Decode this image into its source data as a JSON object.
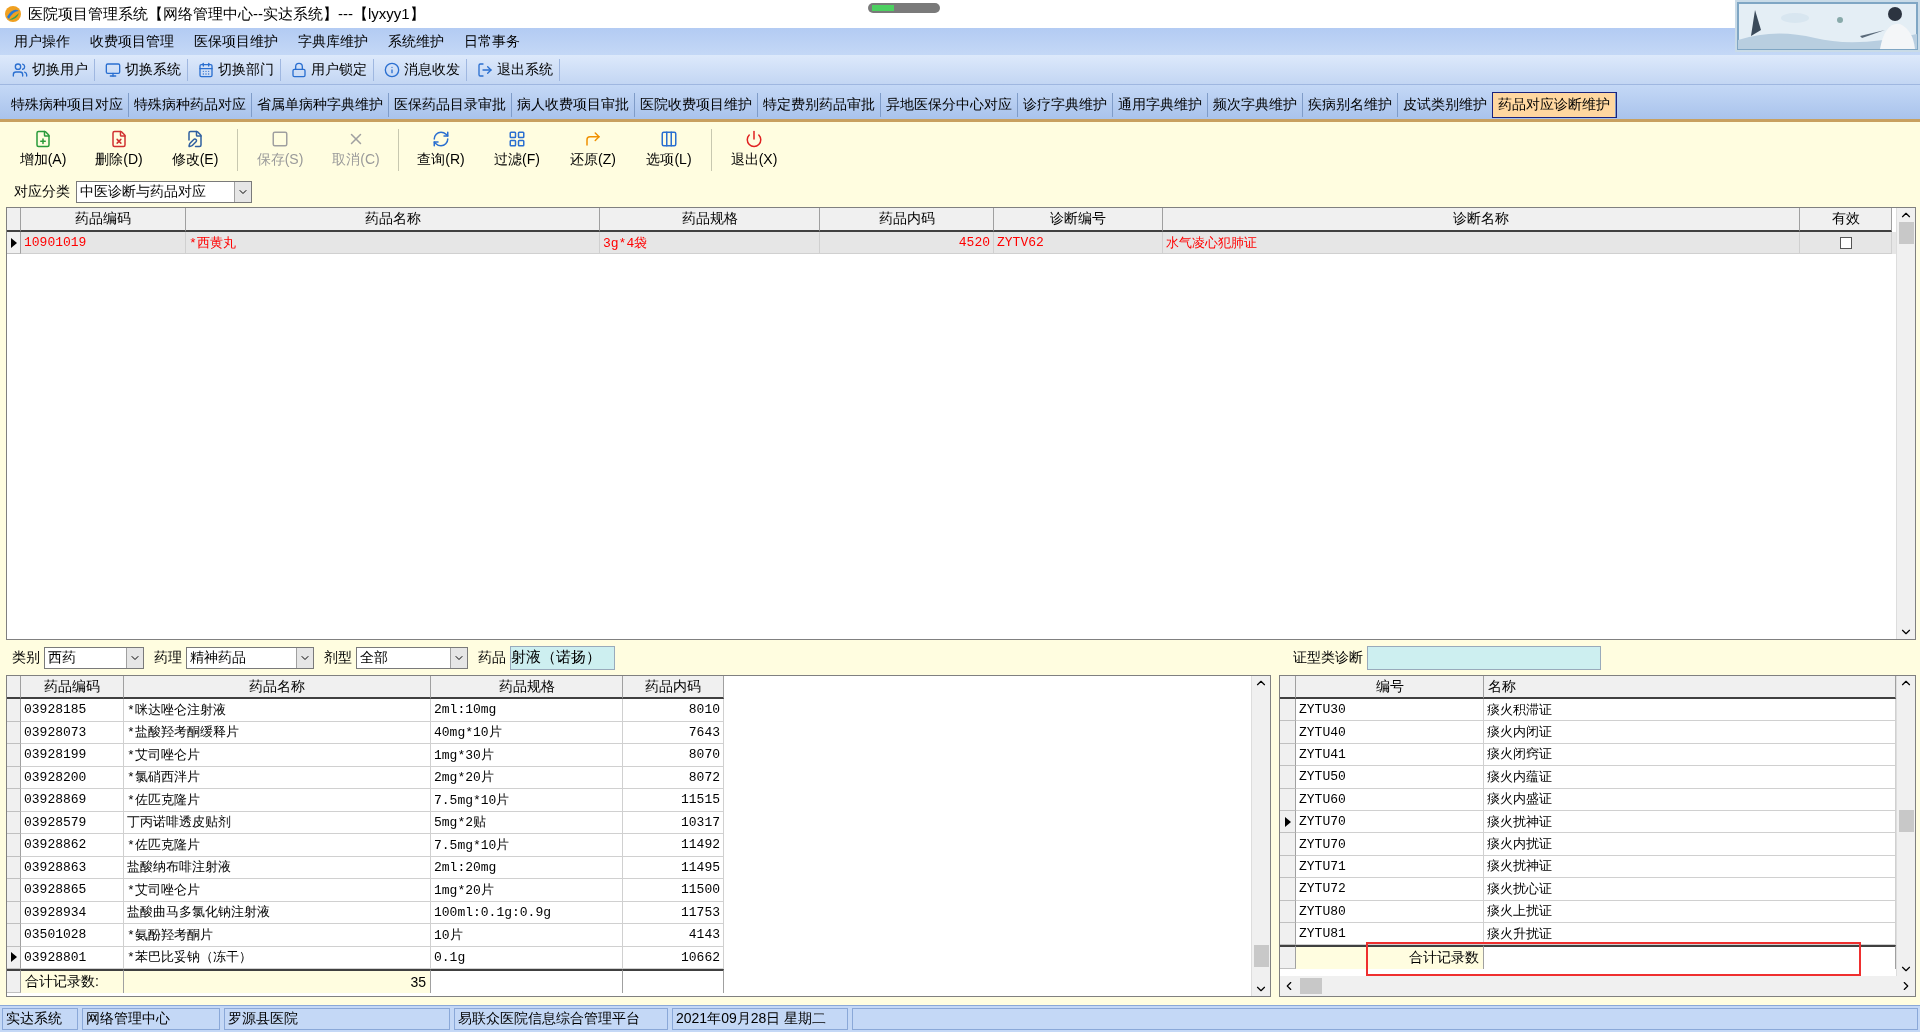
{
  "window": {
    "title": "医院项目管理系统【网络管理中心--实达系统】---【lyxyy1】"
  },
  "menu": [
    "用户操作",
    "收费项目管理",
    "医保项目维护",
    "字典库维护",
    "系统维护",
    "日常事务"
  ],
  "toolbar": [
    {
      "label": "切换用户"
    },
    {
      "label": "切换系统"
    },
    {
      "label": "切换部门"
    },
    {
      "label": "用户锁定"
    },
    {
      "label": "消息收发"
    },
    {
      "label": "退出系统"
    }
  ],
  "tabs": [
    {
      "label": "特殊病种项目对应",
      "selected": false
    },
    {
      "label": "特殊病种药品对应",
      "selected": false
    },
    {
      "label": "省属单病种字典维护",
      "selected": false
    },
    {
      "label": "医保药品目录审批",
      "selected": false
    },
    {
      "label": "病人收费项目审批",
      "selected": false
    },
    {
      "label": "医院收费项目维护",
      "selected": false
    },
    {
      "label": "特定费别药品审批",
      "selected": false
    },
    {
      "label": "异地医保分中心对应",
      "selected": false
    },
    {
      "label": "诊疗字典维护",
      "selected": false
    },
    {
      "label": "通用字典维护",
      "selected": false
    },
    {
      "label": "频次字典维护",
      "selected": false
    },
    {
      "label": "疾病别名维护",
      "selected": false
    },
    {
      "label": "皮试类别维护",
      "selected": false
    },
    {
      "label": "药品对应诊断维护",
      "selected": true
    }
  ],
  "actions": [
    {
      "label": "增加(A)",
      "disabled": false
    },
    {
      "label": "删除(D)",
      "disabled": false
    },
    {
      "label": "修改(E)",
      "disabled": false
    },
    {
      "label": "保存(S)",
      "disabled": true
    },
    {
      "label": "取消(C)",
      "disabled": true
    },
    {
      "label": "查询(R)",
      "disabled": false
    },
    {
      "label": "过滤(F)",
      "disabled": false
    },
    {
      "label": "还原(Z)",
      "disabled": false
    },
    {
      "label": "选项(L)",
      "disabled": false
    },
    {
      "label": "退出(X)",
      "disabled": false
    }
  ],
  "category": {
    "label": "对应分类",
    "value": "中医诊断与药品对应"
  },
  "main_table": {
    "columns": [
      "药品编码",
      "药品名称",
      "药品规格",
      "药品内码",
      "诊断编号",
      "诊断名称",
      "有效"
    ],
    "rows": [
      {
        "cells": [
          "10901019",
          "*西黄丸",
          "3g*4袋",
          "4520",
          "ZYTV62",
          "水气凌心犯肺证"
        ],
        "valid": false,
        "selected": true
      }
    ]
  },
  "filters": [
    {
      "kind": "dropdown",
      "label": "类别",
      "value": "西药"
    },
    {
      "kind": "dropdown",
      "label": "药理",
      "value": "精神药品"
    },
    {
      "kind": "dropdown",
      "label": "剂型",
      "value": "全部"
    },
    {
      "kind": "text",
      "label": "药品",
      "value": "射液（诺扬）"
    }
  ],
  "drug_table": {
    "columns": [
      "药品编码",
      "药品名称",
      "药品规格",
      "药品内码"
    ],
    "rows": [
      {
        "cells": [
          "03928185",
          "*咪达唑仑注射液",
          "2ml:10mg",
          "8010"
        ],
        "selected": false
      },
      {
        "cells": [
          "03928073",
          "*盐酸羟考酮缓释片",
          "40mg*10片",
          "7643"
        ],
        "selected": false
      },
      {
        "cells": [
          "03928199",
          "*艾司唑仑片",
          "1mg*30片",
          "8070"
        ],
        "selected": false
      },
      {
        "cells": [
          "03928200",
          "*氯硝西泮片",
          "2mg*20片",
          "8072"
        ],
        "selected": false
      },
      {
        "cells": [
          "03928869",
          "*佐匹克隆片",
          "7.5mg*10片",
          "11515"
        ],
        "selected": false
      },
      {
        "cells": [
          "03928579",
          "丁丙诺啡透皮贴剂",
          "5mg*2贴",
          "10317"
        ],
        "selected": false
      },
      {
        "cells": [
          "03928862",
          "*佐匹克隆片",
          "7.5mg*10片",
          "11492"
        ],
        "selected": false
      },
      {
        "cells": [
          "03928863",
          "盐酸纳布啡注射液",
          "2ml:20mg",
          "11495"
        ],
        "selected": false
      },
      {
        "cells": [
          "03928865",
          "*艾司唑仑片",
          "1mg*20片",
          "11500"
        ],
        "selected": false
      },
      {
        "cells": [
          "03928934",
          "盐酸曲马多氯化钠注射液",
          "100ml:0.1g:0.9g",
          "11753"
        ],
        "selected": false
      },
      {
        "cells": [
          "03501028",
          "*氨酚羟考酮片",
          "10片",
          "4143"
        ],
        "selected": false
      },
      {
        "cells": [
          "03928801",
          "*苯巴比妥钠（冻干）",
          "0.1g",
          "10662"
        ],
        "selected": true
      }
    ],
    "footer": {
      "label": "合计记录数:",
      "count": "35"
    }
  },
  "diagnosis_filter": {
    "label": "证型类诊断"
  },
  "diagnosis_table": {
    "columns": [
      "编号",
      "名称"
    ],
    "rows": [
      {
        "cells": [
          "ZYTU30",
          "痰火积滞证"
        ],
        "selected": false
      },
      {
        "cells": [
          "ZYTU40",
          "痰火内闭证"
        ],
        "selected": false
      },
      {
        "cells": [
          "ZYTU41",
          "痰火闭窍证"
        ],
        "selected": false
      },
      {
        "cells": [
          "ZYTU50",
          "痰火内蕴证"
        ],
        "selected": false
      },
      {
        "cells": [
          "ZYTU60",
          "痰火内盛证"
        ],
        "selected": false
      },
      {
        "cells": [
          "ZYTU70",
          "痰火扰神证"
        ],
        "selected": true
      },
      {
        "cells": [
          "ZYTU70",
          "痰火内扰证"
        ],
        "selected": false
      },
      {
        "cells": [
          "ZYTU71",
          "痰火扰神证"
        ],
        "selected": false
      },
      {
        "cells": [
          "ZYTU72",
          "痰火扰心证"
        ],
        "selected": false
      },
      {
        "cells": [
          "ZYTU80",
          "痰火上扰证"
        ],
        "selected": false
      },
      {
        "cells": [
          "ZYTU81",
          "痰火升扰证"
        ],
        "selected": false
      }
    ],
    "footer": {
      "label": "合计记录数"
    }
  },
  "status_bar": [
    "实达系统",
    "网络管理中心",
    "罗源县医院",
    "易联众医院信息综合管理平台",
    "2021年09月28日  星期二"
  ]
}
